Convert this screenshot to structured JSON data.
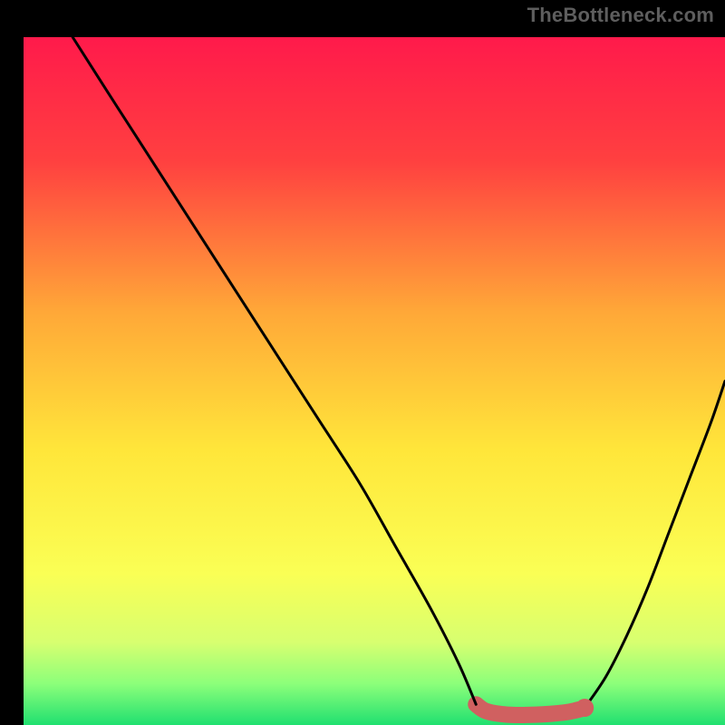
{
  "watermark": "TheBottleneck.com",
  "chart_data": {
    "type": "line",
    "title": "",
    "xlabel": "",
    "ylabel": "",
    "xlim": [
      0,
      100
    ],
    "ylim": [
      0,
      100
    ],
    "gradient_stops": [
      {
        "offset": 0,
        "color": "#ff1a4b"
      },
      {
        "offset": 18,
        "color": "#ff4040"
      },
      {
        "offset": 40,
        "color": "#ffa838"
      },
      {
        "offset": 60,
        "color": "#ffe63a"
      },
      {
        "offset": 78,
        "color": "#faff55"
      },
      {
        "offset": 88,
        "color": "#d7ff70"
      },
      {
        "offset": 94,
        "color": "#8cff7a"
      },
      {
        "offset": 100,
        "color": "#20e070"
      }
    ],
    "series": [
      {
        "name": "left-falling-curve",
        "x": [
          7,
          12,
          18,
          24,
          30,
          36,
          42,
          48,
          53,
          58,
          62,
          64.5
        ],
        "y": [
          100,
          92,
          82.5,
          73,
          63.5,
          54,
          44.5,
          35,
          26,
          17,
          9,
          3
        ]
      },
      {
        "name": "right-rising-curve",
        "x": [
          80,
          83,
          86,
          89,
          92,
          95,
          98,
          100
        ],
        "y": [
          2.5,
          7,
          13,
          20,
          28,
          36,
          44,
          50
        ]
      },
      {
        "name": "bottom-red-band",
        "x": [
          64.5,
          66,
          69,
          73,
          77,
          79,
          80
        ],
        "y": [
          3,
          2,
          1.5,
          1.5,
          1.8,
          2.2,
          2.5
        ]
      }
    ],
    "marker": {
      "x": 80,
      "y": 2.5
    },
    "colors": {
      "curve": "#000000",
      "band": "#d06060",
      "marker": "#d06060",
      "background_frame": "#000000"
    }
  }
}
